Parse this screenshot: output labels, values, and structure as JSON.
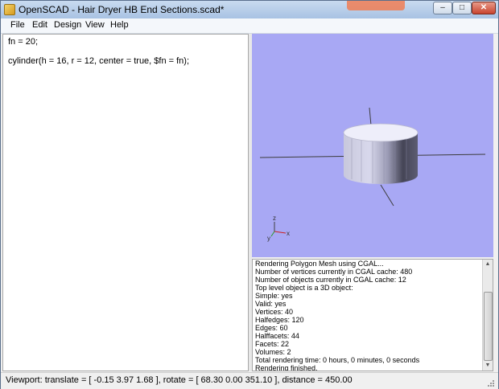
{
  "window": {
    "title": "OpenSCAD - Hair Dryer HB End Sections.scad*"
  },
  "menu": [
    "File",
    "Edit",
    "Design",
    "View",
    "Help"
  ],
  "editor": {
    "lines": [
      "fn = 20;",
      "cylinder(h = 16, r = 12, center = true, $fn = fn);"
    ]
  },
  "viewport": {
    "axis_labels": {
      "z": "z",
      "x": "x",
      "y": "y"
    },
    "colors": {
      "background": "#a8a8f4",
      "cylinder_light": "#dcdcec",
      "cylinder_dark": "#3a3a4a",
      "axis": "#404040"
    }
  },
  "console": {
    "lines": [
      "Rendering Polygon Mesh using CGAL...",
      "Number of vertices currently in CGAL cache: 480",
      "Number of objects currently in CGAL cache: 12",
      "   Top level object is a 3D object:",
      "   Simple:        yes",
      "   Valid:          yes",
      "   Vertices:        40",
      "   Halfedges:       120",
      "   Edges:           60",
      "   Halffacets:       44",
      "   Facets:           22",
      "   Volumes:           2",
      "Total rendering time: 0 hours, 0 minutes, 0 seconds",
      "Rendering finished."
    ]
  },
  "statusbar": {
    "text": "Viewport: translate = [ -0.15 3.97 1.68 ], rotate = [ 68.30 0.00 351.10 ], distance = 450.00"
  },
  "window_controls": {
    "minimize": "‒",
    "maximize": "□",
    "close": "✕"
  }
}
